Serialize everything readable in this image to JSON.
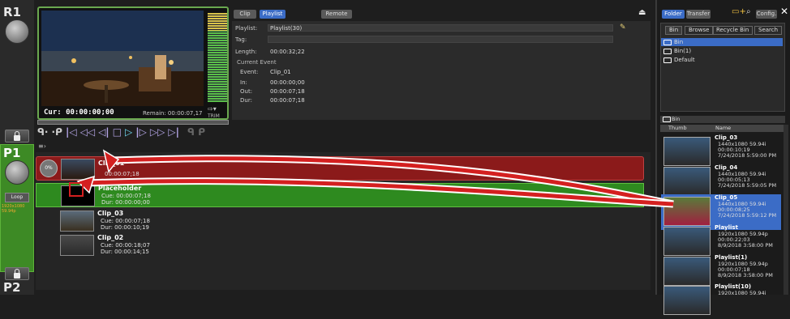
{
  "channels": {
    "r1": {
      "label": "R1"
    },
    "p1": {
      "label": "P1",
      "loop_label": "Loop",
      "side_text": "1920x1080 59.94p"
    },
    "p2": {
      "label": "P2"
    }
  },
  "player": {
    "current_tc": "Cur: 00:00:00;00",
    "remain": "Remain: 00:00:07,17",
    "trim_label": "TRIM"
  },
  "top_tabs": {
    "clip": "Clip",
    "playlist": "Playlist",
    "remote": "Remote"
  },
  "info": {
    "playlist_label": "Playlist:",
    "playlist_value": "Playlist(30)",
    "tag_label": "Tag:",
    "length_label": "Length:",
    "length_value": "00:00:32;22",
    "current_event": "Current Event",
    "event_label": "Event:",
    "event_value": "Clip_01",
    "in_label": "In:",
    "in_value": "00:00:00;00",
    "out_label": "Out:",
    "out_value": "00:00:07;18",
    "dur_label": "Dur:",
    "dur_value": "00:00:07;18"
  },
  "playlist_rows": [
    {
      "name": "Clip_01",
      "line1": "00:00:07;18",
      "line2": "",
      "badge": "0%"
    },
    {
      "name": "Placeholder",
      "line1": "Cue: 00:00:07;18",
      "line2": "Dur: 00:00:00;00"
    },
    {
      "name": "Clip_03",
      "line1": "Cue: 00:00:07;18",
      "line2": "Dur: 00:00:10;19"
    },
    {
      "name": "Clip_02",
      "line1": "Cue: 00:00:18;07",
      "line2": "Dur: 00:00:14;15"
    }
  ],
  "right": {
    "folder_tab": "Folder",
    "transfer_tab": "Transfer",
    "config": "Config.",
    "bin_tabs": [
      "Bin",
      "Browse",
      "Recycle Bin",
      "Search"
    ],
    "bins": [
      "Bin",
      "Bin(1)",
      "Default"
    ],
    "current_bin": "Bin",
    "col_thumb": "Thumb",
    "col_name": "Name",
    "clips": [
      {
        "name": "Clip_03",
        "l1": "1440x1080 59.94i",
        "l2": "00:00:10;19",
        "l3": "7/24/2018 5:59:00 PM",
        "selected": false
      },
      {
        "name": "Clip_04",
        "l1": "1440x1080 59.94i",
        "l2": "00:00:05;13",
        "l3": "7/24/2018 5:59:05 PM",
        "selected": false
      },
      {
        "name": "Clip_05",
        "l1": "1440x1080 59.94i",
        "l2": "00:00:08;25",
        "l3": "7/24/2018 5:59:12 PM",
        "selected": true
      },
      {
        "name": "Playlist",
        "l1": "1920x1080 59.94p",
        "l2": "00:00:22;03",
        "l3": "8/9/2018 3:58:00 PM",
        "selected": false
      },
      {
        "name": "Playlist(1)",
        "l1": "1920x1080 59.94p",
        "l2": "00:00:07;18",
        "l3": "8/9/2018 3:58:00 PM",
        "selected": false
      },
      {
        "name": "Playlist(10)",
        "l1": "1920x1080 59.94i",
        "l2": "",
        "l3": "",
        "selected": false
      }
    ]
  },
  "colors": {
    "accent_green": "#6aa84f",
    "selected_blue": "#3b6cc6",
    "row_red": "#8b1a1a",
    "row_green": "#2e8a1f",
    "arrow": "#d42020"
  }
}
